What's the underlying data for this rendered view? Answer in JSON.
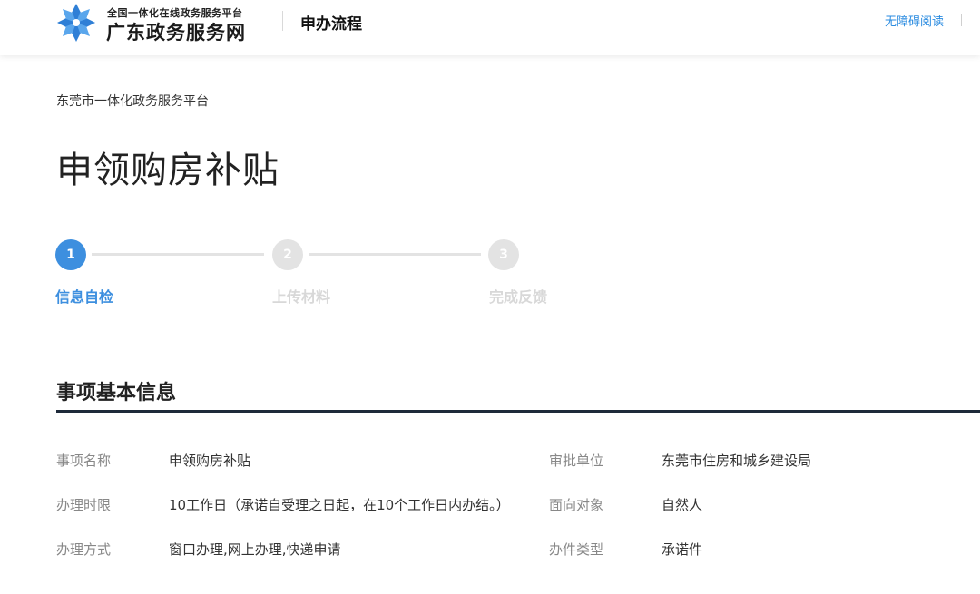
{
  "header": {
    "logo_subtitle": "全国一体化在线政务服务平台",
    "logo_title": "广东政务服务网",
    "page_section": "申办流程",
    "accessibility_label": "无障碍阅读",
    "cut_off_text": "I"
  },
  "breadcrumb": {
    "platform": "东莞市一体化政务服务平台"
  },
  "title": "申领购房补贴",
  "steps": [
    {
      "number": "1",
      "label": "信息自检",
      "state": "active"
    },
    {
      "number": "2",
      "label": "上传材料",
      "state": "inactive"
    },
    {
      "number": "3",
      "label": "完成反馈",
      "state": "inactive"
    }
  ],
  "section": {
    "title": "事项基本信息"
  },
  "info": {
    "item_name_label": "事项名称",
    "item_name_value": "申领购房补贴",
    "approval_unit_label": "审批单位",
    "approval_unit_value": "东莞市住房和城乡建设局",
    "time_limit_label": "办理时限",
    "time_limit_value": "10工作日（承诺自受理之日起，在10个工作日内办结。）",
    "target_label": "面向对象",
    "target_value": "自然人",
    "method_label": "办理方式",
    "method_value": "窗口办理,网上办理,快递申请",
    "type_label": "办件类型",
    "type_value": "承诺件"
  },
  "colors": {
    "accent": "#3d8fdf",
    "inactive": "#e3e3e3",
    "rule": "#1e2a3a"
  },
  "icons": {
    "logo": "pinwheel-logo-icon"
  }
}
